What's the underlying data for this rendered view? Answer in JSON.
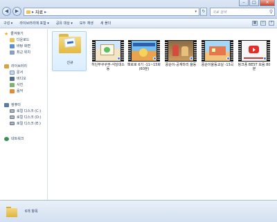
{
  "window": {
    "minimize_label": "–",
    "maximize_label": "□",
    "close_label": "×"
  },
  "nav": {
    "back_label": "◀",
    "forward_label": "▶"
  },
  "address": {
    "path": [
      "자료"
    ],
    "separator": "▸",
    "dropdown": "▾",
    "refresh": "↻"
  },
  "search": {
    "placeholder": "자료 검색",
    "icon": "search-icon"
  },
  "toolbar": {
    "items": [
      "구성 ▾",
      "라이브러리에 포함 ▾",
      "공유 대상 ▾",
      "모두 재생",
      "새 폴더"
    ],
    "view_icon": "▦",
    "pane_icon": "▭",
    "help_icon": "?"
  },
  "sidebar": {
    "favorites": {
      "header": "즐겨찾기",
      "items": [
        "다운로드",
        "바탕 화면",
        "최근 위치"
      ]
    },
    "libraries": {
      "header": "라이브러리",
      "items": [
        "문서",
        "비디오",
        "사진",
        "음악"
      ]
    },
    "computer": {
      "header": "컴퓨터",
      "items": [
        "로컬 디스크 (C:)",
        "로컬 디스크 (D:)",
        "로컬 디스크 (E:)"
      ]
    },
    "network": {
      "header": "네트워크"
    }
  },
  "files": [
    {
      "name": "신규",
      "type": "folder",
      "selected": true
    },
    {
      "name": "히딘부쿠쿠부-식당대소동",
      "type": "video"
    },
    {
      "name": "뽀로로 6기 -11~15화(60분)",
      "type": "video"
    },
    {
      "name": "콩순이-공계마리 율동",
      "type": "video"
    },
    {
      "name": "콩순이율동교실 -13곡",
      "type": "video"
    },
    {
      "name": "핑크퐁 BEST 모음 80분",
      "type": "video"
    }
  ],
  "status": {
    "item_count": "6개 항목"
  },
  "colors": {
    "toolbar_bg": "#dbe7f5",
    "accent": "#1e395b",
    "selection": "#cce8ff"
  }
}
